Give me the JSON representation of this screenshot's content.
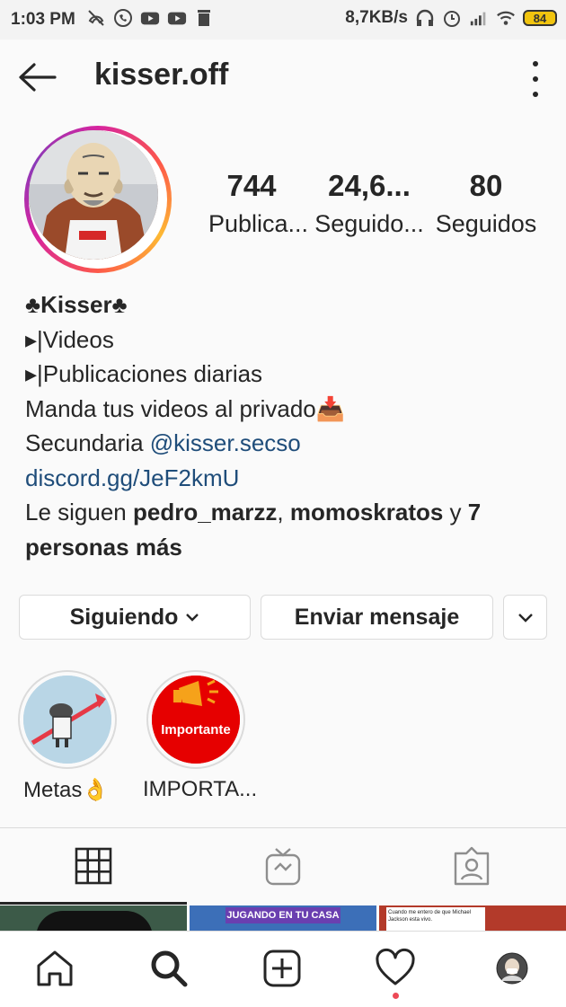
{
  "status_bar": {
    "time": "1:03 PM",
    "speed": "8,7KB/s",
    "battery": "84",
    "icons_left": [
      "phone-off-icon",
      "whatsapp-icon",
      "youtube-icon",
      "youtube-icon",
      "trash-icon"
    ],
    "icons_right": [
      "headphones-icon",
      "alarm-icon",
      "signal-icon",
      "wifi-icon",
      "battery-icon"
    ]
  },
  "header": {
    "username": "kisser.off"
  },
  "stats": [
    {
      "value": "744",
      "label": "Publica..."
    },
    {
      "value": "24,6...",
      "label": "Seguido..."
    },
    {
      "value": "80",
      "label": "Seguidos"
    }
  ],
  "bio": {
    "name": "♣Kisser♣",
    "line1": "▸|Videos",
    "line2": "▸|Publicaciones diarias",
    "line3": "Manda tus videos al privado📥",
    "line4_prefix": "Secundaria ",
    "line4_link": "@kisser.secso",
    "line5_link": "discord.gg/JeF2kmU",
    "followed_prefix": "Le siguen ",
    "followed_user1": "pedro_marzz",
    "followed_sep": ", ",
    "followed_user2": "momoskratos",
    "followed_and": " y ",
    "followed_more": "7 personas más"
  },
  "actions": {
    "following": "Siguiendo",
    "message": "Enviar mensaje"
  },
  "highlights": [
    {
      "label": "Metas👌"
    },
    {
      "label": "IMPORTA...",
      "badge": "Importante"
    }
  ],
  "thumbs": {
    "middle_caption": "JUGANDO EN TU CASA",
    "right_caption": "Cuando me entero de que Michael Jackson esta vivo."
  },
  "colors": {
    "link": "#1f4d7a",
    "ring_gradient": [
      "#d6249f",
      "#fd5949",
      "#fdb933"
    ],
    "notification_dot": "#ed4956"
  }
}
